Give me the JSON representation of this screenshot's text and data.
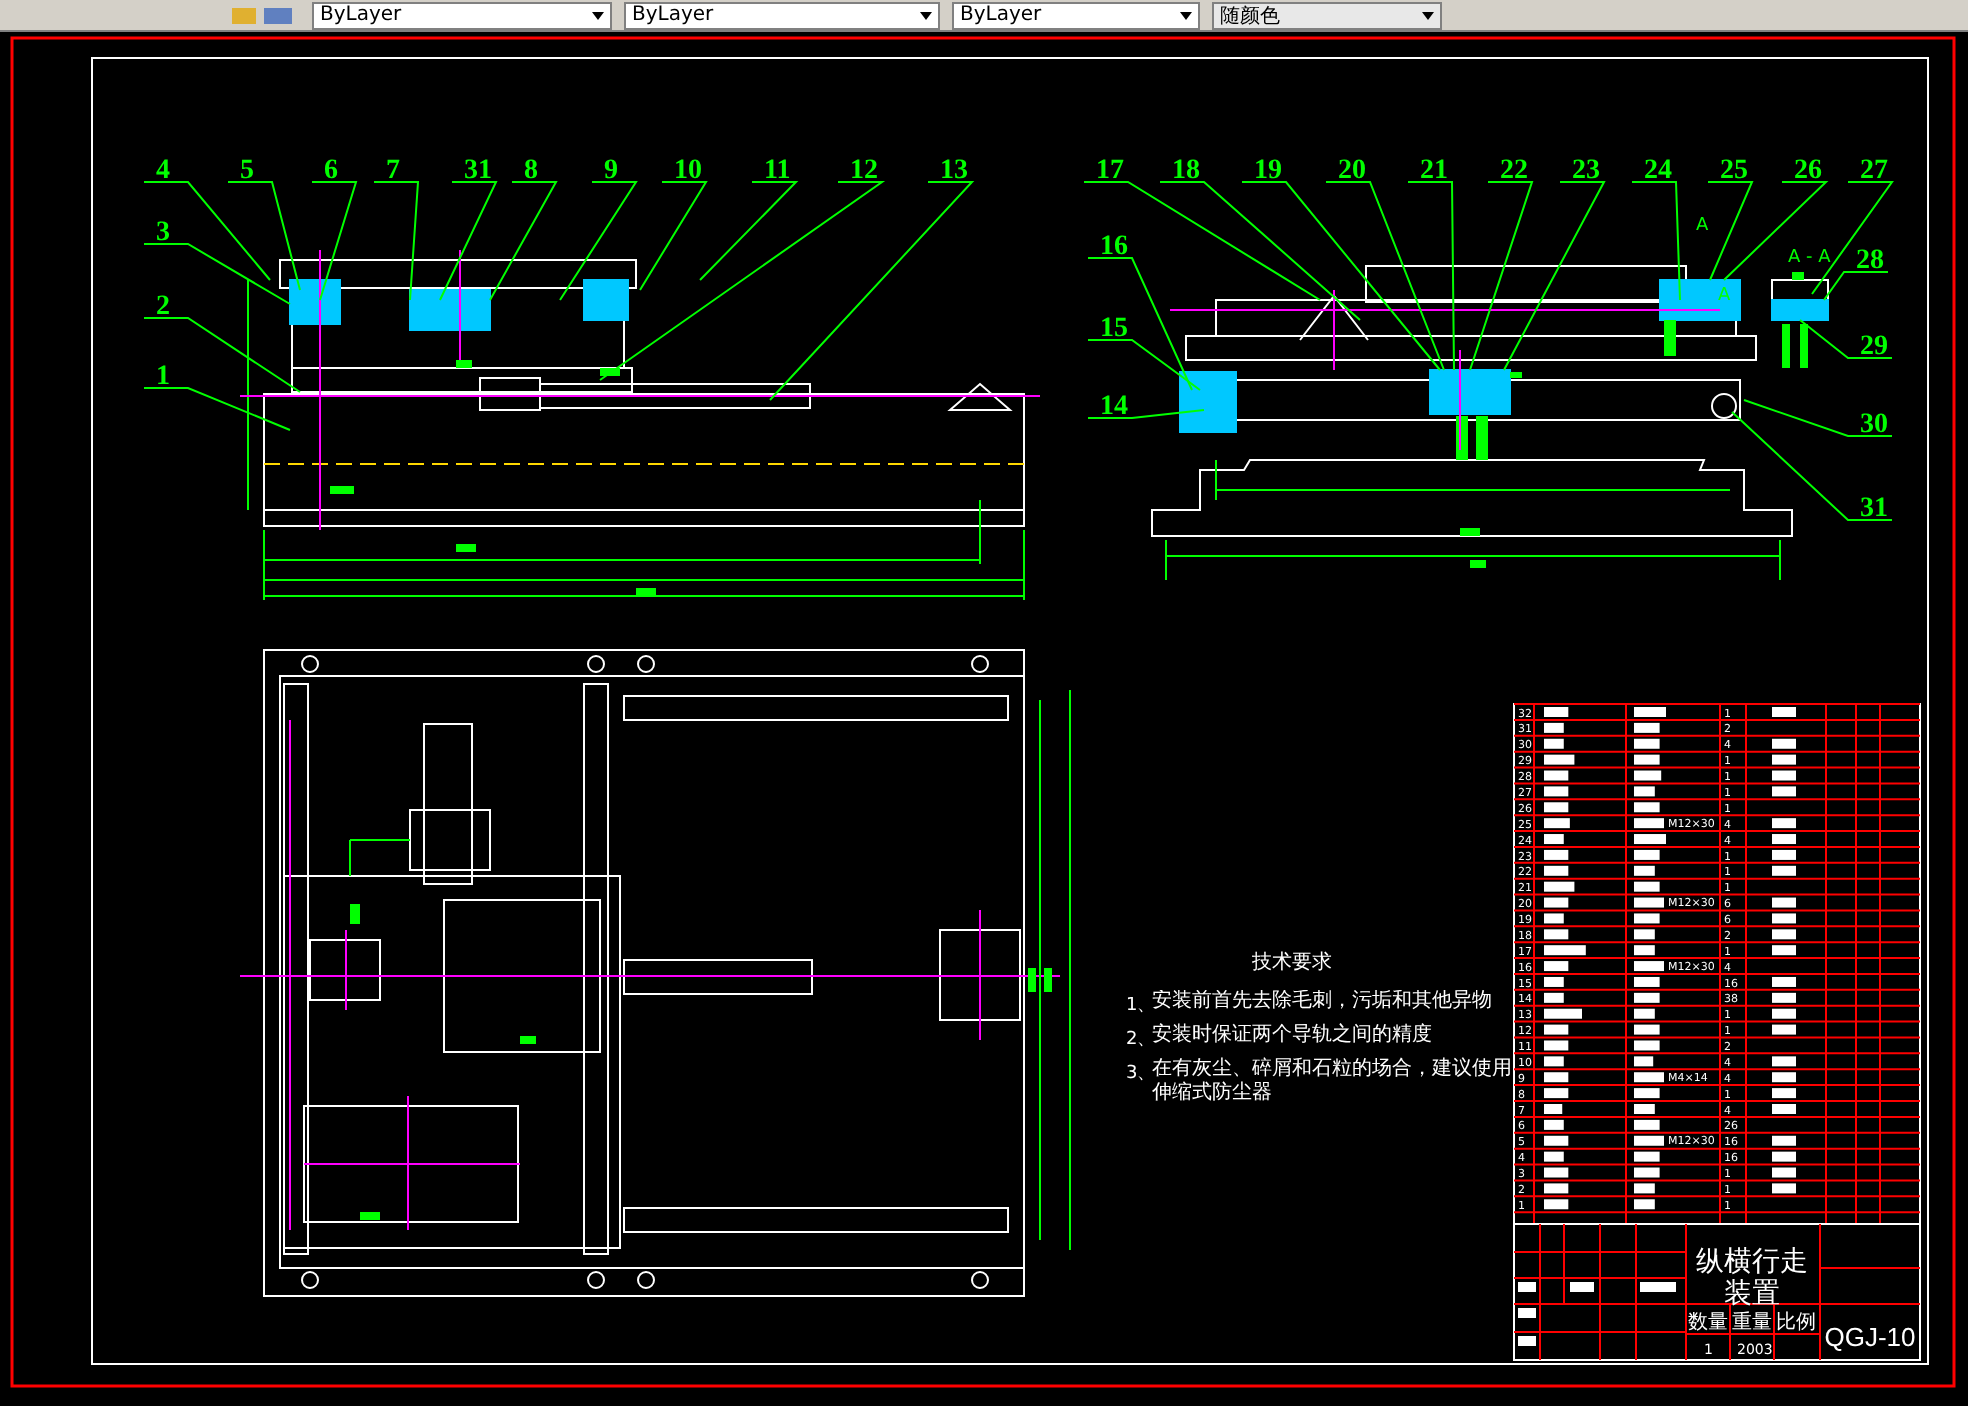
{
  "toolbar": {
    "dropdowns": [
      {
        "label": "ByLayer"
      },
      {
        "label": "ByLayer"
      },
      {
        "label": "ByLayer"
      },
      {
        "label": "随颜色"
      }
    ]
  },
  "front_view": {
    "callouts": [
      {
        "label": "4"
      },
      {
        "label": "5"
      },
      {
        "label": "6"
      },
      {
        "label": "7"
      },
      {
        "label": "31"
      },
      {
        "label": "8"
      },
      {
        "label": "9"
      },
      {
        "label": "10"
      },
      {
        "label": "11"
      },
      {
        "label": "12"
      },
      {
        "label": "13"
      },
      {
        "label": "3"
      },
      {
        "label": "2"
      },
      {
        "label": "1"
      }
    ]
  },
  "side_view": {
    "callouts": [
      {
        "label": "17"
      },
      {
        "label": "18"
      },
      {
        "label": "19"
      },
      {
        "label": "20"
      },
      {
        "label": "21"
      },
      {
        "label": "22"
      },
      {
        "label": "23"
      },
      {
        "label": "24"
      },
      {
        "label": "25"
      },
      {
        "label": "26"
      },
      {
        "label": "27"
      },
      {
        "label": "28"
      },
      {
        "label": "29"
      },
      {
        "label": "30"
      },
      {
        "label": "31"
      },
      {
        "label": "16"
      },
      {
        "label": "15"
      },
      {
        "label": "14"
      }
    ],
    "section_marks": [
      "A",
      "A - A",
      "A"
    ]
  },
  "tech_requirements": {
    "title": "技术要求",
    "items": [
      {
        "number": "1、",
        "text": "安装前首先去除毛刺，污垢和其他异物"
      },
      {
        "number": "2、",
        "text": "安装时保证两个导轨之间的精度"
      },
      {
        "number": "3、",
        "text": "在有灰尘、碎屑和石粒的场合，建议使用伸缩式防尘器"
      }
    ]
  },
  "parts_list": {
    "rows": [
      {
        "no": "32",
        "qty": "1"
      },
      {
        "no": "31",
        "qty": "2"
      },
      {
        "no": "30",
        "qty": "4"
      },
      {
        "no": "29",
        "qty": "1"
      },
      {
        "no": "28",
        "qty": "1"
      },
      {
        "no": "27",
        "qty": "1"
      },
      {
        "no": "26",
        "qty": "1"
      },
      {
        "no": "25",
        "qty": "4",
        "spec": "M12×30"
      },
      {
        "no": "24",
        "qty": "4"
      },
      {
        "no": "23",
        "qty": "1"
      },
      {
        "no": "22",
        "qty": "1"
      },
      {
        "no": "21",
        "qty": "1"
      },
      {
        "no": "20",
        "qty": "6",
        "spec": "M12×30"
      },
      {
        "no": "19",
        "qty": "6"
      },
      {
        "no": "18",
        "qty": "2"
      },
      {
        "no": "17",
        "qty": "1"
      },
      {
        "no": "16",
        "qty": "4",
        "spec": "M12×30"
      },
      {
        "no": "15",
        "qty": "16"
      },
      {
        "no": "14",
        "qty": "38"
      },
      {
        "no": "13",
        "qty": "1"
      },
      {
        "no": "12",
        "qty": "1"
      },
      {
        "no": "11",
        "qty": "2"
      },
      {
        "no": "10",
        "qty": "4"
      },
      {
        "no": "9",
        "qty": "4",
        "spec": "M4×14"
      },
      {
        "no": "8",
        "qty": "1"
      },
      {
        "no": "7",
        "qty": "4"
      },
      {
        "no": "6",
        "qty": "26"
      },
      {
        "no": "5",
        "qty": "16",
        "spec": "M12×30"
      },
      {
        "no": "4",
        "qty": "16"
      },
      {
        "no": "3",
        "qty": "1"
      },
      {
        "no": "2",
        "qty": "1"
      },
      {
        "no": "1",
        "qty": "1"
      }
    ]
  },
  "title_block": {
    "name_lines": [
      "纵横行走",
      "装置"
    ],
    "labels": [
      "数量",
      "重量",
      "比例"
    ],
    "values": [
      "1",
      "2003"
    ],
    "code": "QGJ-10"
  }
}
